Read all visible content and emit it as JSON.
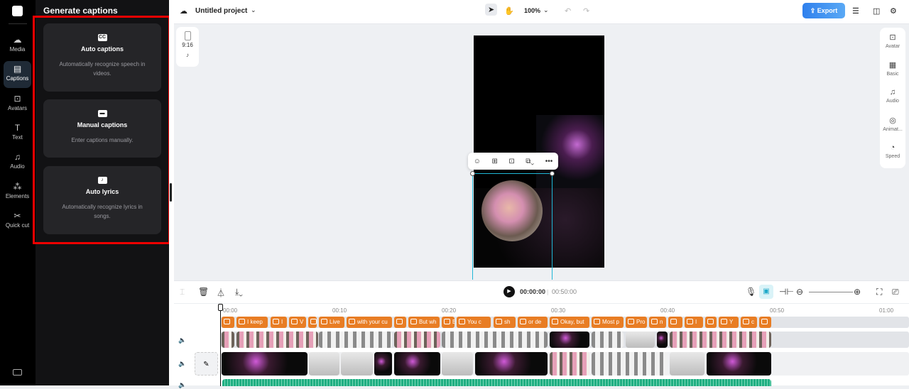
{
  "nav": {
    "items": [
      {
        "label": "Media",
        "icon": "cloud-upload-icon"
      },
      {
        "label": "Captions",
        "icon": "captions-icon",
        "active": true
      },
      {
        "label": "Avatars",
        "icon": "avatar-icon"
      },
      {
        "label": "Text",
        "icon": "text-icon"
      },
      {
        "label": "Audio",
        "icon": "music-icon"
      },
      {
        "label": "Elements",
        "icon": "elements-icon"
      },
      {
        "label": "Quick cut",
        "icon": "quick-cut-icon"
      }
    ]
  },
  "panel": {
    "title": "Generate captions",
    "cards": [
      {
        "title": "Auto captions",
        "desc": "Automatically recognize speech in videos.",
        "icon": "cc-icon"
      },
      {
        "title": "Manual captions",
        "desc": "Enter captions manually.",
        "icon": "keyboard-icon"
      },
      {
        "title": "Auto lyrics",
        "desc": "Automatically recognize lyrics in songs.",
        "icon": "lyrics-icon"
      }
    ]
  },
  "topbar": {
    "project_name": "Untitled project",
    "zoom": "100%",
    "export_label": "Export"
  },
  "ratio": {
    "label": "9:16"
  },
  "right_panel": [
    {
      "label": "Avatar"
    },
    {
      "label": "Basic"
    },
    {
      "label": "Audio"
    },
    {
      "label": "Animat..."
    },
    {
      "label": "Speed"
    }
  ],
  "timeline": {
    "current_time": "00:00:00",
    "total_time": "00:50:00",
    "ruler": [
      "00:00",
      "00:10",
      "00:20",
      "00:30",
      "00:40",
      "00:50",
      "01:00"
    ],
    "captions": [
      "",
      "I keep",
      "I",
      "V",
      "(",
      "Live",
      "with your cu",
      "",
      "But wh",
      "E",
      "You c",
      "sh",
      "or de",
      "Okay, but",
      "Most p",
      "Pro",
      "n",
      "",
      "I",
      "",
      "Y",
      "c",
      ""
    ]
  },
  "colors": {
    "accent": "#2f80ed",
    "caption_chip": "#e87d24",
    "audio": "#1fae82",
    "highlight": "#ee0000"
  }
}
